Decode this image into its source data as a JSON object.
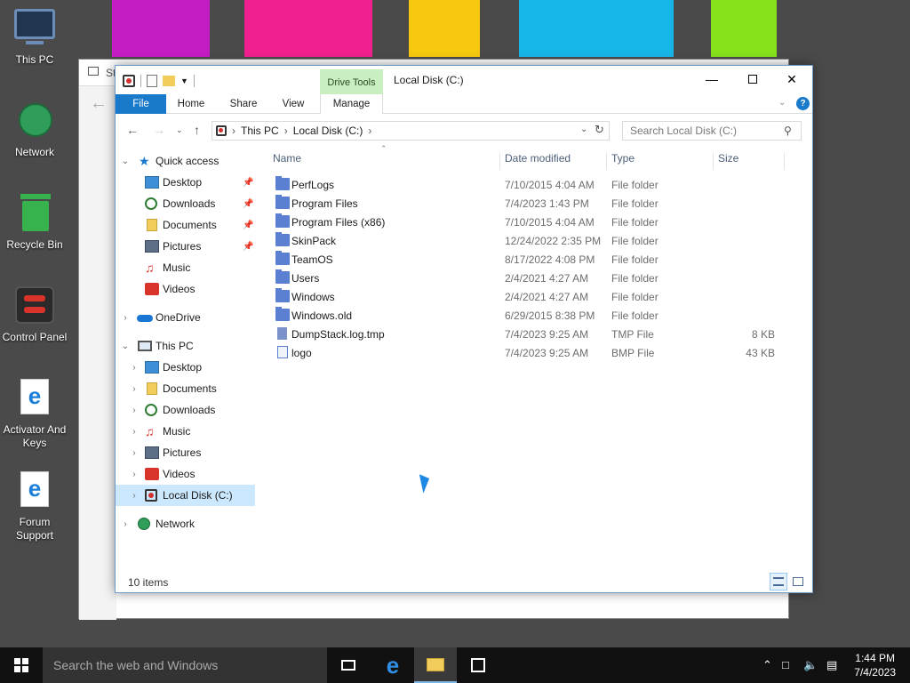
{
  "desktop": {
    "stripes": [
      "#c51dc4",
      "#f0208e",
      "#f6c90f",
      "#17b6e8",
      "#86e11b"
    ],
    "icons": [
      {
        "label": "This PC",
        "icon": "monitor-icon"
      },
      {
        "label": "Network",
        "icon": "globe-icon"
      },
      {
        "label": "Recycle Bin",
        "icon": "trash-icon"
      },
      {
        "label": "Control Panel",
        "icon": "control-panel-icon"
      },
      {
        "label": "Activator And Keys",
        "icon": "edge-icon"
      },
      {
        "label": "Forum Support",
        "icon": "edge-icon"
      }
    ]
  },
  "background_window": {
    "title_fragment": "St"
  },
  "window": {
    "title": "Local Disk (C:)",
    "context_tab_group": "Drive Tools",
    "tabs": [
      "File",
      "Home",
      "Share",
      "View",
      "Manage"
    ],
    "address": [
      "This PC",
      "Local Disk (C:)"
    ],
    "search_placeholder": "Search Local Disk (C:)",
    "help_label": "?",
    "columns": [
      "Name",
      "Date modified",
      "Type",
      "Size"
    ],
    "nav": {
      "quick_access": "Quick access",
      "quick_items": [
        "Desktop",
        "Downloads",
        "Documents",
        "Pictures",
        "Music",
        "Videos"
      ],
      "onedrive": "OneDrive",
      "this_pc": "This PC",
      "pc_items": [
        "Desktop",
        "Documents",
        "Downloads",
        "Music",
        "Pictures",
        "Videos",
        "Local Disk (C:)"
      ],
      "network": "Network"
    },
    "files": [
      {
        "name": "PerfLogs",
        "date": "7/10/2015 4:04 AM",
        "type": "File folder",
        "size": "",
        "kind": "folder"
      },
      {
        "name": "Program Files",
        "date": "7/4/2023 1:43 PM",
        "type": "File folder",
        "size": "",
        "kind": "folder"
      },
      {
        "name": "Program Files (x86)",
        "date": "7/10/2015 4:04 AM",
        "type": "File folder",
        "size": "",
        "kind": "folder"
      },
      {
        "name": "SkinPack",
        "date": "12/24/2022 2:35 PM",
        "type": "File folder",
        "size": "",
        "kind": "folder"
      },
      {
        "name": "TeamOS",
        "date": "8/17/2022 4:08 PM",
        "type": "File folder",
        "size": "",
        "kind": "folder"
      },
      {
        "name": "Users",
        "date": "2/4/2021 4:27 AM",
        "type": "File folder",
        "size": "",
        "kind": "folder"
      },
      {
        "name": "Windows",
        "date": "2/4/2021 4:27 AM",
        "type": "File folder",
        "size": "",
        "kind": "folder"
      },
      {
        "name": "Windows.old",
        "date": "6/29/2015 8:38 PM",
        "type": "File folder",
        "size": "",
        "kind": "folder"
      },
      {
        "name": "DumpStack.log.tmp",
        "date": "7/4/2023 9:25 AM",
        "type": "TMP File",
        "size": "8 KB",
        "kind": "file"
      },
      {
        "name": "logo",
        "date": "7/4/2023 9:25 AM",
        "type": "BMP File",
        "size": "43 KB",
        "kind": "image"
      }
    ],
    "status": "10 items"
  },
  "taskbar": {
    "search_placeholder": "Search the web and Windows",
    "time": "1:44 PM",
    "date": "7/4/2023"
  }
}
